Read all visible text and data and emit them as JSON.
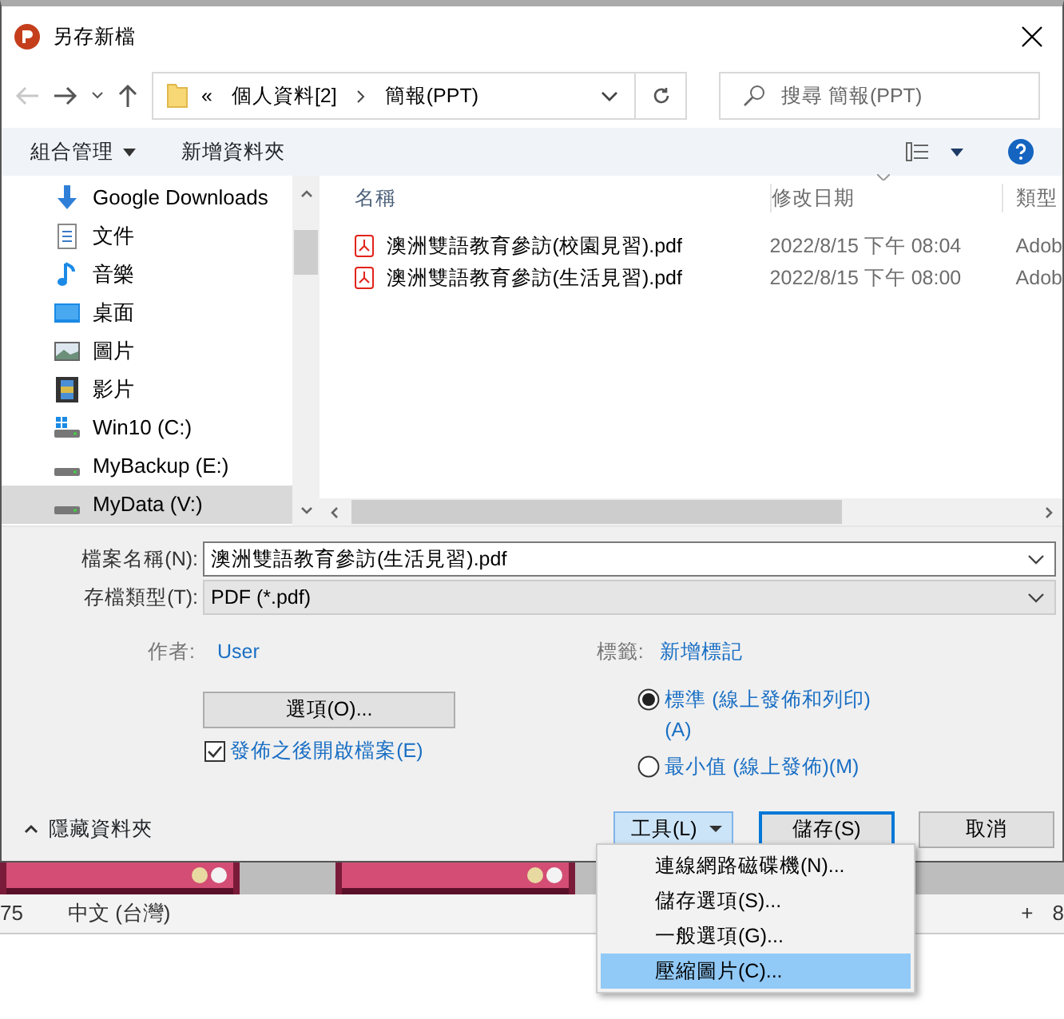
{
  "window": {
    "title": "另存新檔"
  },
  "nav": {
    "back_disabled": true,
    "address": {
      "overflow_mark": "«",
      "segments": [
        "個人資料[2]",
        "簡報(PPT)"
      ]
    },
    "search": {
      "placeholder": "搜尋 簡報(PPT)"
    }
  },
  "toolbar": {
    "organize": "組合管理",
    "new_folder": "新增資料夾"
  },
  "sidebar": {
    "items": [
      {
        "name": "Google Downloads",
        "kind": "download",
        "selected": false
      },
      {
        "name": "文件",
        "kind": "documents",
        "selected": false
      },
      {
        "name": "音樂",
        "kind": "music",
        "selected": false
      },
      {
        "name": "桌面",
        "kind": "desktop",
        "selected": false
      },
      {
        "name": "圖片",
        "kind": "pictures",
        "selected": false
      },
      {
        "name": "影片",
        "kind": "videos",
        "selected": false
      },
      {
        "name": "Win10 (C:)",
        "kind": "system-drive",
        "selected": false
      },
      {
        "name": "MyBackup (E:)",
        "kind": "drive",
        "selected": false
      },
      {
        "name": "MyData (V:)",
        "kind": "drive",
        "selected": true
      }
    ]
  },
  "table": {
    "columns": [
      "名稱",
      "修改日期",
      "類型"
    ],
    "rows": [
      {
        "name": "澳洲雙語教育參訪(校園見習).pdf",
        "modified": "2022/8/15 下午 08:04",
        "type": "Adob"
      },
      {
        "name": "澳洲雙語教育參訪(生活見習).pdf",
        "modified": "2022/8/15 下午 08:00",
        "type": "Adob"
      }
    ]
  },
  "form": {
    "file_name": {
      "label": "檔案名稱(N):",
      "value": "澳洲雙語教育參訪(生活見習).pdf"
    },
    "file_type": {
      "label": "存檔類型(T):",
      "value": "PDF (*.pdf)"
    },
    "author": {
      "label": "作者:",
      "value": "User"
    },
    "tags": {
      "label": "標籤:",
      "value": "新增標記"
    },
    "options_button": "選項(O)...",
    "open_after": {
      "label": "發佈之後開啟檔案(E)",
      "checked": true
    },
    "optimize": [
      {
        "label": "標準 (線上發佈和列印)(A)",
        "selected": true
      },
      {
        "label": "最小值 (線上發佈)(M)",
        "selected": false
      }
    ]
  },
  "footer": {
    "hide_folders": "隱藏資料夾",
    "tools": "工具(L)",
    "save": "儲存(S)",
    "cancel": "取消"
  },
  "tools_menu": [
    {
      "label": "連線網路磁碟機(N)...",
      "selected": false
    },
    {
      "label": "儲存選項(S)...",
      "selected": false
    },
    {
      "label": "一般選項(G)...",
      "selected": false
    },
    {
      "label": "壓縮圖片(C)...",
      "selected": true
    }
  ],
  "background_app": {
    "status_bar": [
      "75",
      "中文 (台灣)",
      "+",
      "8"
    ]
  }
}
